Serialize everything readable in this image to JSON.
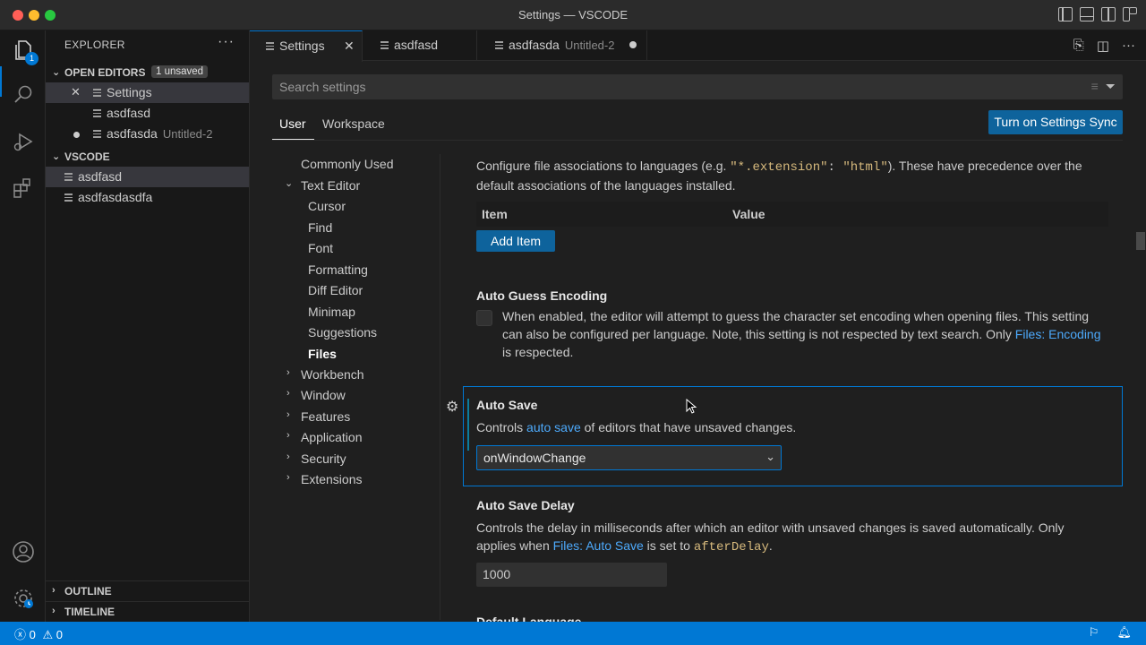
{
  "window": {
    "title": "Settings — VSCODE"
  },
  "activity_bar": {
    "explorer_badge": "1",
    "items": [
      "files-icon",
      "search-icon",
      "run-debug-icon",
      "extensions-icon",
      "account-icon",
      "manage-gear-icon"
    ]
  },
  "sidebar": {
    "header": "EXPLORER",
    "more": "···",
    "open_editors": {
      "label": "OPEN EDITORS",
      "badge": "1 unsaved",
      "items": [
        {
          "label": "Settings",
          "desc": ""
        },
        {
          "label": "asdfasd",
          "desc": ""
        },
        {
          "label": "asdfasda",
          "desc": "Untitled-2"
        }
      ]
    },
    "folder": {
      "label": "VSCODE",
      "files": [
        "asdfasd",
        "asdfasdasdfa"
      ]
    },
    "outline_label": "OUTLINE",
    "timeline_label": "TIMELINE"
  },
  "tabs": [
    {
      "label": "Settings",
      "desc": ""
    },
    {
      "label": "asdfasd",
      "desc": ""
    },
    {
      "label": "asdfasda",
      "desc": "Untitled-2"
    }
  ],
  "settings": {
    "search_placeholder": "Search settings",
    "scope_tabs": [
      "User",
      "Workspace"
    ],
    "sync_button": "Turn on Settings Sync",
    "toc": {
      "commonly_used": "Commonly Used",
      "text_editor": "Text Editor",
      "text_editor_children": [
        "Cursor",
        "Find",
        "Font",
        "Formatting",
        "Diff Editor",
        "Minimap",
        "Suggestions",
        "Files"
      ],
      "collapsed": [
        "Workbench",
        "Window",
        "Features",
        "Application",
        "Security",
        "Extensions"
      ]
    },
    "file_associations": {
      "desc_pre": "Configure file associations to languages (e.g. ",
      "code_key": "\"*.extension\"",
      "code_colon": ": ",
      "code_val": "\"html\"",
      "desc_post": "). These have precedence over the default associations of the languages installed.",
      "col_item": "Item",
      "col_value": "Value",
      "add_button": "Add Item"
    },
    "auto_guess_encoding": {
      "title": "Auto Guess Encoding",
      "desc": "When enabled, the editor will attempt to guess the character set encoding when opening files. This setting can also be configured per language. Note, this setting is not respected by text search. Only ",
      "link": "Files: Encoding",
      "desc_post": " is respected."
    },
    "auto_save": {
      "title": "Auto Save",
      "desc_pre": "Controls ",
      "link": "auto save",
      "desc_post": " of editors that have unsaved changes.",
      "value": "onWindowChange"
    },
    "auto_save_delay": {
      "title": "Auto Save Delay",
      "desc_pre": "Controls the delay in milliseconds after which an editor with unsaved changes is saved automatically. Only applies when ",
      "link": "Files: Auto Save",
      "desc_mid": " is set to ",
      "code": "afterDelay",
      "desc_post": ".",
      "value": "1000"
    },
    "next_title": "Default Language"
  },
  "status_bar": {
    "errors": "0",
    "warnings": "0"
  },
  "colors": {
    "accent": "#0078d4",
    "button": "#0e639c",
    "link": "#4daafc"
  }
}
